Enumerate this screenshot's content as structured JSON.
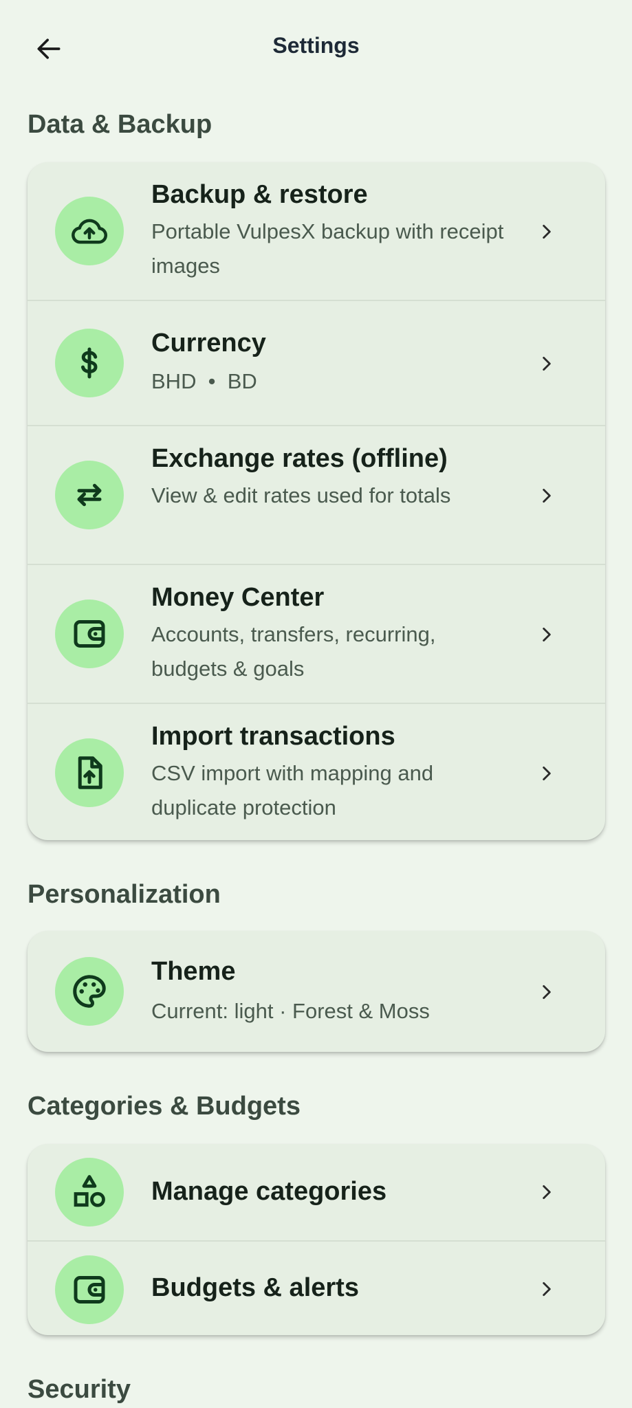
{
  "header": {
    "title": "Settings"
  },
  "sections": {
    "data_backup": {
      "title": "Data & Backup",
      "items": [
        {
          "title": "Backup & restore",
          "subtitle": "Portable VulpesX backup with receipt images",
          "icon": "cloud-upload-icon"
        },
        {
          "title": "Currency",
          "subtitle": "BHD  •  BD",
          "icon": "dollar-icon"
        },
        {
          "title": "Exchange rates (offline)",
          "subtitle": "View & edit rates used for totals",
          "icon": "swap-arrows-icon"
        },
        {
          "title": "Money Center",
          "subtitle": "Accounts, transfers, recurring, budgets & goals",
          "icon": "wallet-icon"
        },
        {
          "title": "Import transactions",
          "subtitle": "CSV import with mapping and duplicate protection",
          "icon": "file-upload-icon"
        }
      ]
    },
    "personalization": {
      "title": "Personalization",
      "items": [
        {
          "title": "Theme",
          "subtitle": "Current: light · Forest & Moss",
          "icon": "palette-icon"
        }
      ]
    },
    "categories_budgets": {
      "title": "Categories & Budgets",
      "items": [
        {
          "title": "Manage categories",
          "icon": "shapes-icon"
        },
        {
          "title": "Budgets & alerts",
          "icon": "wallet-icon"
        }
      ]
    },
    "security": {
      "title": "Security"
    }
  },
  "colors": {
    "background": "#eef5ec",
    "card": "#e6efe3",
    "icon_circle": "#a9eda5",
    "icon_stroke": "#0f3a1c"
  }
}
